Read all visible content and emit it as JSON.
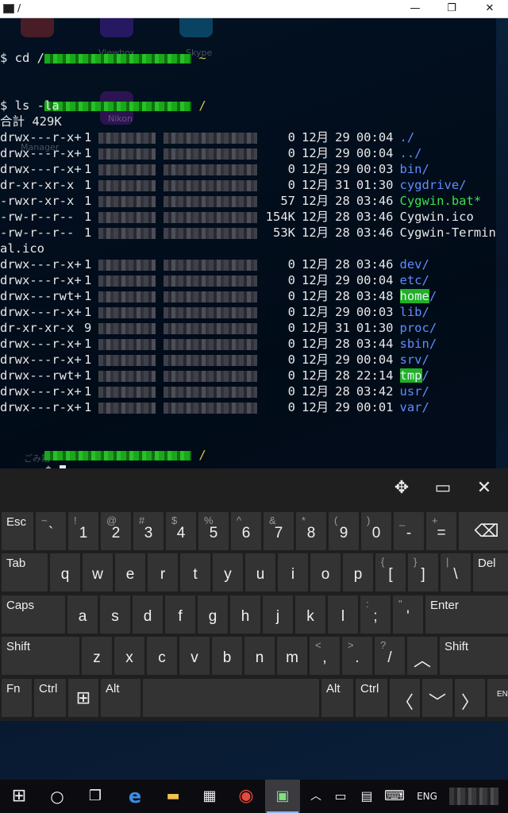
{
  "window": {
    "title": "/",
    "minimize": "—",
    "maximize": "❐",
    "close": "✕"
  },
  "desktop_ghost_labels": [
    "Viewbox",
    "Skype",
    "Nikon",
    "ごみ箱",
    "Manager"
  ],
  "terminal": {
    "prompt_path_home": "~",
    "prompt_path_root": "/",
    "cmd1": "$ cd /",
    "cmd2": "$ ls -la",
    "total": "合計 429K",
    "prompt_final": "$ ",
    "listing": [
      {
        "perms": "drwx---r-x+",
        "links": "1",
        "size": "0",
        "month": "12月",
        "day": "29",
        "time": "00:04",
        "name": "./",
        "kind": "dir"
      },
      {
        "perms": "drwx---r-x+",
        "links": "1",
        "size": "0",
        "month": "12月",
        "day": "29",
        "time": "00:04",
        "name": "../",
        "kind": "dir"
      },
      {
        "perms": "drwx---r-x+",
        "links": "1",
        "size": "0",
        "month": "12月",
        "day": "29",
        "time": "00:03",
        "name": "bin/",
        "kind": "dir"
      },
      {
        "perms": "dr-xr-xr-x",
        "links": "1",
        "size": "0",
        "month": "12月",
        "day": "31",
        "time": "01:30",
        "name": "cygdrive/",
        "kind": "dir"
      },
      {
        "perms": "-rwxr-xr-x",
        "links": "1",
        "size": "57",
        "month": "12月",
        "day": "28",
        "time": "03:46",
        "name": "Cygwin.bat*",
        "kind": "exe"
      },
      {
        "perms": "-rw-r--r--",
        "links": "1",
        "size": "154K",
        "month": "12月",
        "day": "28",
        "time": "03:46",
        "name": "Cygwin.ico",
        "kind": "file"
      },
      {
        "perms": "-rw-r--r--",
        "links": "1",
        "size": "53K",
        "month": "12月",
        "day": "28",
        "time": "03:46",
        "name": "Cygwin-Termin",
        "kind": "file",
        "wrap": "al.ico"
      },
      {
        "perms": "drwx---r-x+",
        "links": "1",
        "size": "0",
        "month": "12月",
        "day": "28",
        "time": "03:46",
        "name": "dev/",
        "kind": "dir"
      },
      {
        "perms": "drwx---r-x+",
        "links": "1",
        "size": "0",
        "month": "12月",
        "day": "29",
        "time": "00:04",
        "name": "etc/",
        "kind": "dir"
      },
      {
        "perms": "drwx---rwt+",
        "links": "1",
        "size": "0",
        "month": "12月",
        "day": "28",
        "time": "03:48",
        "name": "home",
        "kind": "hl"
      },
      {
        "perms": "drwx---r-x+",
        "links": "1",
        "size": "0",
        "month": "12月",
        "day": "29",
        "time": "00:03",
        "name": "lib/",
        "kind": "dir"
      },
      {
        "perms": "dr-xr-xr-x",
        "links": "9",
        "size": "0",
        "month": "12月",
        "day": "31",
        "time": "01:30",
        "name": "proc/",
        "kind": "dir"
      },
      {
        "perms": "drwx---r-x+",
        "links": "1",
        "size": "0",
        "month": "12月",
        "day": "28",
        "time": "03:44",
        "name": "sbin/",
        "kind": "dir"
      },
      {
        "perms": "drwx---r-x+",
        "links": "1",
        "size": "0",
        "month": "12月",
        "day": "29",
        "time": "00:04",
        "name": "srv/",
        "kind": "dir"
      },
      {
        "perms": "drwx---rwt+",
        "links": "1",
        "size": "0",
        "month": "12月",
        "day": "28",
        "time": "22:14",
        "name": "tmp",
        "kind": "hl"
      },
      {
        "perms": "drwx---r-x+",
        "links": "1",
        "size": "0",
        "month": "12月",
        "day": "28",
        "time": "03:42",
        "name": "usr/",
        "kind": "dir"
      },
      {
        "perms": "drwx---r-x+",
        "links": "1",
        "size": "0",
        "month": "12月",
        "day": "29",
        "time": "00:01",
        "name": "var/",
        "kind": "dir"
      }
    ]
  },
  "keyboard": {
    "toolbar": {
      "move": "✥",
      "dock": "▭",
      "close": "✕"
    },
    "rows": [
      [
        {
          "id": "esc",
          "label": "Esc"
        },
        {
          "id": "backtick",
          "main": "`",
          "sec": "~"
        },
        {
          "id": "1",
          "main": "1",
          "sec": "!"
        },
        {
          "id": "2",
          "main": "2",
          "sec": "@"
        },
        {
          "id": "3",
          "main": "3",
          "sec": "#"
        },
        {
          "id": "4",
          "main": "4",
          "sec": "$"
        },
        {
          "id": "5",
          "main": "5",
          "sec": "%"
        },
        {
          "id": "6",
          "main": "6",
          "sec": "^"
        },
        {
          "id": "7",
          "main": "7",
          "sec": "&"
        },
        {
          "id": "8",
          "main": "8",
          "sec": "*"
        },
        {
          "id": "9",
          "main": "9",
          "sec": "("
        },
        {
          "id": "0",
          "main": "0",
          "sec": ")"
        },
        {
          "id": "minus",
          "main": "-",
          "sec": "_"
        },
        {
          "id": "equals",
          "main": "=",
          "sec": "+"
        },
        {
          "id": "backspace",
          "glyph": "⌫"
        }
      ],
      [
        {
          "id": "tab",
          "label": "Tab"
        },
        {
          "id": "q",
          "main": "q"
        },
        {
          "id": "w",
          "main": "w"
        },
        {
          "id": "e",
          "main": "e"
        },
        {
          "id": "r",
          "main": "r"
        },
        {
          "id": "t",
          "main": "t"
        },
        {
          "id": "y",
          "main": "y"
        },
        {
          "id": "u",
          "main": "u"
        },
        {
          "id": "i",
          "main": "i"
        },
        {
          "id": "o",
          "main": "o"
        },
        {
          "id": "p",
          "main": "p"
        },
        {
          "id": "lbracket",
          "main": "[",
          "sec": "{"
        },
        {
          "id": "rbracket",
          "main": "]",
          "sec": "}"
        },
        {
          "id": "backslash",
          "main": "\\",
          "sec": "|"
        },
        {
          "id": "del",
          "label": "Del"
        }
      ],
      [
        {
          "id": "caps",
          "label": "Caps"
        },
        {
          "id": "a",
          "main": "a"
        },
        {
          "id": "s",
          "main": "s"
        },
        {
          "id": "d",
          "main": "d"
        },
        {
          "id": "f",
          "main": "f"
        },
        {
          "id": "g",
          "main": "g"
        },
        {
          "id": "h",
          "main": "h"
        },
        {
          "id": "j",
          "main": "j"
        },
        {
          "id": "k",
          "main": "k"
        },
        {
          "id": "l",
          "main": "l"
        },
        {
          "id": "semicolon",
          "main": ";",
          "sec": ":"
        },
        {
          "id": "quote",
          "main": "'",
          "sec": "\""
        },
        {
          "id": "enter",
          "label": "Enter"
        }
      ],
      [
        {
          "id": "lshift",
          "label": "Shift"
        },
        {
          "id": "z",
          "main": "z"
        },
        {
          "id": "x",
          "main": "x"
        },
        {
          "id": "c",
          "main": "c"
        },
        {
          "id": "v",
          "main": "v"
        },
        {
          "id": "b",
          "main": "b"
        },
        {
          "id": "n",
          "main": "n"
        },
        {
          "id": "m",
          "main": "m"
        },
        {
          "id": "comma",
          "main": ",",
          "sec": "<"
        },
        {
          "id": "period",
          "main": ".",
          "sec": ">"
        },
        {
          "id": "slash",
          "main": "/",
          "sec": "?"
        },
        {
          "id": "up",
          "glyph": "︿"
        },
        {
          "id": "rshift",
          "label": "Shift"
        }
      ],
      [
        {
          "id": "fn",
          "label": "Fn"
        },
        {
          "id": "lctrl",
          "label": "Ctrl"
        },
        {
          "id": "win",
          "glyph": "⊞"
        },
        {
          "id": "lalt",
          "label": "Alt"
        },
        {
          "id": "space"
        },
        {
          "id": "ralt",
          "label": "Alt"
        },
        {
          "id": "rctrl",
          "label": "Ctrl"
        },
        {
          "id": "left",
          "glyph": "〈"
        },
        {
          "id": "down",
          "glyph": "﹀"
        },
        {
          "id": "right",
          "glyph": "〉"
        },
        {
          "id": "lang",
          "label": "ENG"
        }
      ]
    ]
  },
  "taskbar": {
    "start": "⊞",
    "search": "○",
    "taskview": "❐",
    "edge": "e",
    "explorer": "▬",
    "store": "▦",
    "chrome": "◉",
    "terminal": "▣",
    "tray_up": "︿",
    "battery": "▭",
    "action": "▤",
    "kbd": "⌨",
    "lang": "ENG",
    "colors": {
      "edge": "#3a8ee6",
      "explorer": "#f2c14e",
      "chrome": "#e54b3c",
      "accent": "#8ab4f8"
    }
  }
}
